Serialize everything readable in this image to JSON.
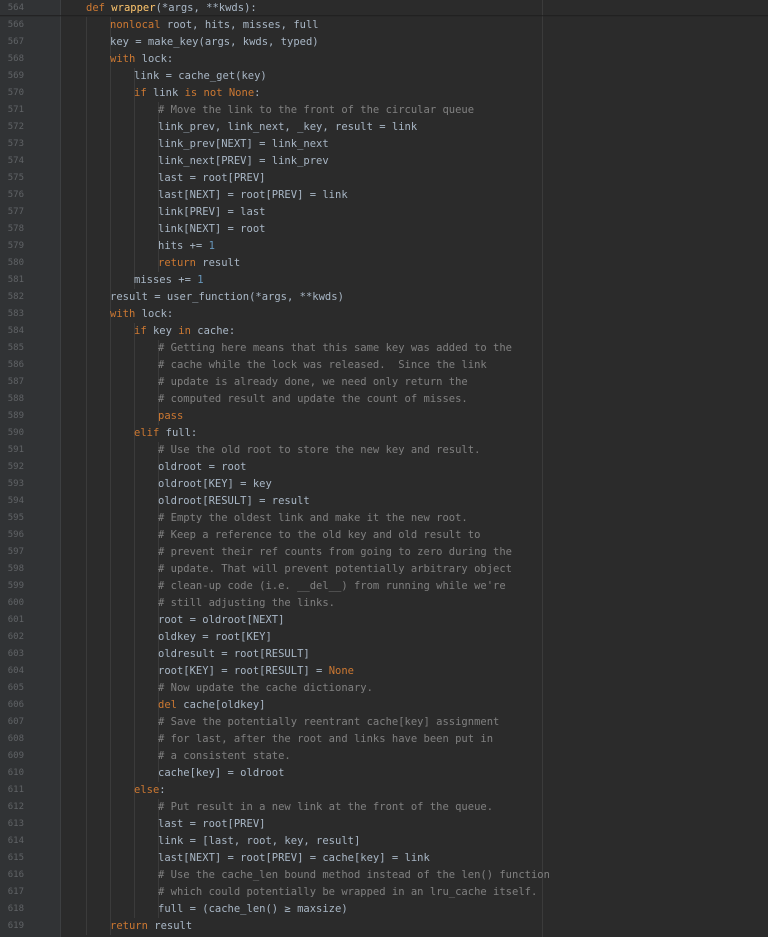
{
  "editor": {
    "theme": {
      "background": "#2b2b2b",
      "gutter": "#313335",
      "line_number": "#606366",
      "text": "#a9b7c6",
      "keyword": "#cc7832",
      "function": "#ffc66d",
      "number": "#6897bb",
      "comment": "#808080"
    },
    "lines": [
      {
        "n": "564",
        "indent": 1,
        "tokens": [
          [
            "def",
            "kw"
          ],
          [
            " ",
            "pl"
          ],
          [
            "wrapper",
            "fn"
          ],
          [
            "(*args, **kwds):",
            "pl"
          ]
        ]
      },
      {
        "n": "566",
        "indent": 2,
        "tokens": [
          [
            "nonlocal",
            "kw"
          ],
          [
            " root, hits, misses, full",
            "pl"
          ]
        ]
      },
      {
        "n": "567",
        "indent": 2,
        "tokens": [
          [
            "key = make_key(args, kwds, typed)",
            "pl"
          ]
        ]
      },
      {
        "n": "568",
        "indent": 2,
        "tokens": [
          [
            "with",
            "kw"
          ],
          [
            " lock:",
            "pl"
          ]
        ]
      },
      {
        "n": "569",
        "indent": 3,
        "tokens": [
          [
            "link = cache_get(key)",
            "pl"
          ]
        ]
      },
      {
        "n": "570",
        "indent": 3,
        "tokens": [
          [
            "if",
            "kw"
          ],
          [
            " link ",
            "pl"
          ],
          [
            "is not",
            "kw"
          ],
          [
            " ",
            "pl"
          ],
          [
            "None",
            "kw"
          ],
          [
            ":",
            "pl"
          ]
        ]
      },
      {
        "n": "571",
        "indent": 4,
        "tokens": [
          [
            "# Move the link to the front of the circular queue",
            "cm"
          ]
        ]
      },
      {
        "n": "572",
        "indent": 4,
        "tokens": [
          [
            "link_prev, link_next, _key, result = link",
            "pl"
          ]
        ]
      },
      {
        "n": "573",
        "indent": 4,
        "tokens": [
          [
            "link_prev[NEXT] = link_next",
            "pl"
          ]
        ]
      },
      {
        "n": "574",
        "indent": 4,
        "tokens": [
          [
            "link_next[PREV] = link_prev",
            "pl"
          ]
        ]
      },
      {
        "n": "575",
        "indent": 4,
        "tokens": [
          [
            "last = root[PREV]",
            "pl"
          ]
        ]
      },
      {
        "n": "576",
        "indent": 4,
        "tokens": [
          [
            "last[NEXT] = root[PREV] = link",
            "pl"
          ]
        ]
      },
      {
        "n": "577",
        "indent": 4,
        "tokens": [
          [
            "link[PREV] = last",
            "pl"
          ]
        ]
      },
      {
        "n": "578",
        "indent": 4,
        "tokens": [
          [
            "link[NEXT] = root",
            "pl"
          ]
        ]
      },
      {
        "n": "579",
        "indent": 4,
        "tokens": [
          [
            "hits += ",
            "pl"
          ],
          [
            "1",
            "num"
          ]
        ]
      },
      {
        "n": "580",
        "indent": 4,
        "tokens": [
          [
            "return",
            "kw"
          ],
          [
            " result",
            "pl"
          ]
        ]
      },
      {
        "n": "581",
        "indent": 3,
        "tokens": [
          [
            "misses += ",
            "pl"
          ],
          [
            "1",
            "num"
          ]
        ]
      },
      {
        "n": "582",
        "indent": 2,
        "tokens": [
          [
            "result = user_function(*args, **kwds)",
            "pl"
          ]
        ]
      },
      {
        "n": "583",
        "indent": 2,
        "tokens": [
          [
            "with",
            "kw"
          ],
          [
            " lock:",
            "pl"
          ]
        ]
      },
      {
        "n": "584",
        "indent": 3,
        "tokens": [
          [
            "if",
            "kw"
          ],
          [
            " key ",
            "pl"
          ],
          [
            "in",
            "kw"
          ],
          [
            " cache:",
            "pl"
          ]
        ]
      },
      {
        "n": "585",
        "indent": 4,
        "tokens": [
          [
            "# Getting here means that this same key was added to the",
            "cm"
          ]
        ]
      },
      {
        "n": "586",
        "indent": 4,
        "tokens": [
          [
            "# cache while the lock was released.  Since the link",
            "cm"
          ]
        ]
      },
      {
        "n": "587",
        "indent": 4,
        "tokens": [
          [
            "# update is already done, we need only return the",
            "cm"
          ]
        ]
      },
      {
        "n": "588",
        "indent": 4,
        "tokens": [
          [
            "# computed result and update the count of misses.",
            "cm"
          ]
        ]
      },
      {
        "n": "589",
        "indent": 4,
        "tokens": [
          [
            "pass",
            "kw"
          ]
        ]
      },
      {
        "n": "590",
        "indent": 3,
        "tokens": [
          [
            "elif",
            "kw"
          ],
          [
            " full:",
            "pl"
          ]
        ]
      },
      {
        "n": "591",
        "indent": 4,
        "tokens": [
          [
            "# Use the old root to store the new key and result.",
            "cm"
          ]
        ]
      },
      {
        "n": "592",
        "indent": 4,
        "tokens": [
          [
            "oldroot = root",
            "pl"
          ]
        ]
      },
      {
        "n": "593",
        "indent": 4,
        "tokens": [
          [
            "oldroot[KEY] = key",
            "pl"
          ]
        ]
      },
      {
        "n": "594",
        "indent": 4,
        "tokens": [
          [
            "oldroot[RESULT] = result",
            "pl"
          ]
        ]
      },
      {
        "n": "595",
        "indent": 4,
        "tokens": [
          [
            "# Empty the oldest link and make it the new root.",
            "cm"
          ]
        ]
      },
      {
        "n": "596",
        "indent": 4,
        "tokens": [
          [
            "# Keep a reference to the old key and old result to",
            "cm"
          ]
        ]
      },
      {
        "n": "597",
        "indent": 4,
        "tokens": [
          [
            "# prevent their ref counts from going to zero during the",
            "cm"
          ]
        ]
      },
      {
        "n": "598",
        "indent": 4,
        "tokens": [
          [
            "# update. That will prevent potentially arbitrary object",
            "cm"
          ]
        ]
      },
      {
        "n": "599",
        "indent": 4,
        "tokens": [
          [
            "# clean-up code (i.e. __del__) from running while we're",
            "cm"
          ]
        ]
      },
      {
        "n": "600",
        "indent": 4,
        "tokens": [
          [
            "# still adjusting the links.",
            "cm"
          ]
        ]
      },
      {
        "n": "601",
        "indent": 4,
        "tokens": [
          [
            "root = oldroot[NEXT]",
            "pl"
          ]
        ]
      },
      {
        "n": "602",
        "indent": 4,
        "tokens": [
          [
            "oldkey = root[KEY]",
            "pl"
          ]
        ]
      },
      {
        "n": "603",
        "indent": 4,
        "tokens": [
          [
            "oldresult = root[RESULT]",
            "pl"
          ]
        ]
      },
      {
        "n": "604",
        "indent": 4,
        "tokens": [
          [
            "root[KEY] = root[RESULT] = ",
            "pl"
          ],
          [
            "None",
            "kw"
          ]
        ]
      },
      {
        "n": "605",
        "indent": 4,
        "tokens": [
          [
            "# Now update the cache dictionary.",
            "cm"
          ]
        ]
      },
      {
        "n": "606",
        "indent": 4,
        "tokens": [
          [
            "del",
            "kw"
          ],
          [
            " cache[oldkey]",
            "pl"
          ]
        ]
      },
      {
        "n": "607",
        "indent": 4,
        "tokens": [
          [
            "# Save the potentially reentrant cache[key] assignment",
            "cm"
          ]
        ]
      },
      {
        "n": "608",
        "indent": 4,
        "tokens": [
          [
            "# for last, after the root and links have been put in",
            "cm"
          ]
        ]
      },
      {
        "n": "609",
        "indent": 4,
        "tokens": [
          [
            "# a consistent state.",
            "cm"
          ]
        ]
      },
      {
        "n": "610",
        "indent": 4,
        "tokens": [
          [
            "cache[key] = oldroot",
            "pl"
          ]
        ]
      },
      {
        "n": "611",
        "indent": 3,
        "tokens": [
          [
            "else",
            "kw"
          ],
          [
            ":",
            "pl"
          ]
        ]
      },
      {
        "n": "612",
        "indent": 4,
        "tokens": [
          [
            "# Put result in a new link at the front of the queue.",
            "cm"
          ]
        ]
      },
      {
        "n": "613",
        "indent": 4,
        "tokens": [
          [
            "last = root[PREV]",
            "pl"
          ]
        ]
      },
      {
        "n": "614",
        "indent": 4,
        "tokens": [
          [
            "link = [last, root, key, result]",
            "pl"
          ]
        ]
      },
      {
        "n": "615",
        "indent": 4,
        "tokens": [
          [
            "last[NEXT] = root[PREV] = cache[key] = link",
            "pl"
          ]
        ]
      },
      {
        "n": "616",
        "indent": 4,
        "tokens": [
          [
            "# Use the cache_len bound method instead of the len() function",
            "cm"
          ]
        ]
      },
      {
        "n": "617",
        "indent": 4,
        "tokens": [
          [
            "# which could potentially be wrapped in an lru_cache itself.",
            "cm"
          ]
        ]
      },
      {
        "n": "618",
        "indent": 4,
        "tokens": [
          [
            "full = (cache_len() ≥ maxsize)",
            "pl"
          ]
        ]
      },
      {
        "n": "619",
        "indent": 2,
        "tokens": [
          [
            "return",
            "kw"
          ],
          [
            " result",
            "pl"
          ]
        ]
      }
    ]
  }
}
